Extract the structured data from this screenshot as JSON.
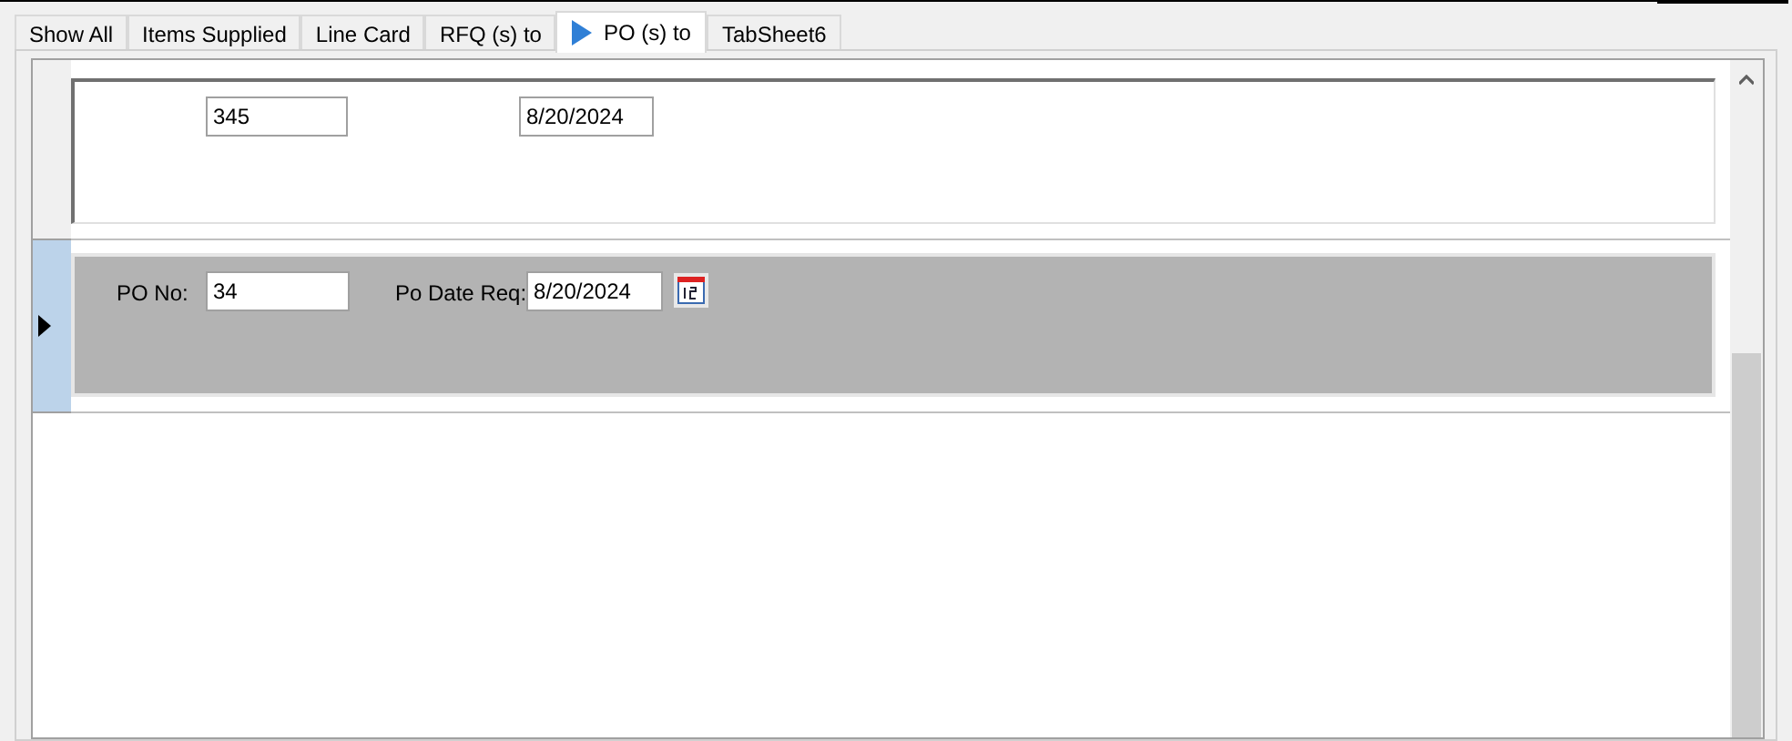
{
  "tabs": [
    {
      "label": "Show All",
      "selected": false
    },
    {
      "label": "Items Supplied",
      "selected": false
    },
    {
      "label": "Line Card",
      "selected": false
    },
    {
      "label": "RFQ (s) to",
      "selected": false
    },
    {
      "label": "PO (s) to",
      "selected": true
    },
    {
      "label": "TabSheet6",
      "selected": false
    }
  ],
  "records": [
    {
      "po_no": "345",
      "po_date": "8/20/2024",
      "current": false
    },
    {
      "po_no_label": "PO No:",
      "po_no": "34",
      "date_label": "Po Date Req:",
      "po_date": "8/20/2024",
      "current": true
    }
  ]
}
